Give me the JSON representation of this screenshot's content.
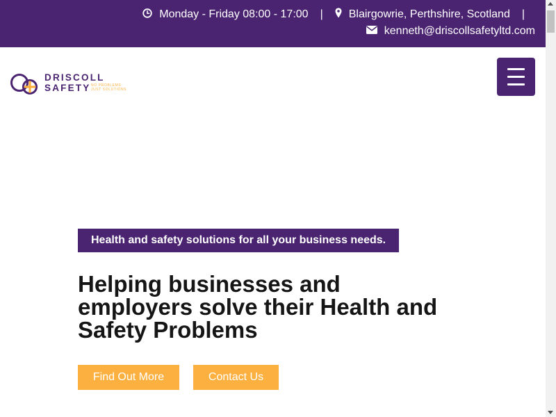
{
  "topbar": {
    "hours": "Monday - Friday 08:00 - 17:00",
    "separator": "|",
    "location": "Blairgowrie, Perthshire, Scotland",
    "email": "kenneth@driscollsafetyltd.com",
    "icons": [
      "clock-icon",
      "map-marker-icon",
      "envelope-icon"
    ]
  },
  "logo": {
    "line1": "DRISCOLL",
    "line2": "SAFETY",
    "tagline1": "NO PROBLEMS",
    "tagline2": "JUST SOLUTIONS"
  },
  "nav": {
    "menu_icon": "hamburger-icon"
  },
  "hero": {
    "tagline": "Health and safety solutions for all your business needs.",
    "headline": "Helping businesses and employers solve their Health and Safety Problems",
    "primary_button": "Find Out More",
    "secondary_button": "Contact Us"
  },
  "colors": {
    "brand_purple": "#4a2371",
    "accent_orange": "#fbb040",
    "text_dark": "#151515",
    "white": "#ffffff"
  }
}
